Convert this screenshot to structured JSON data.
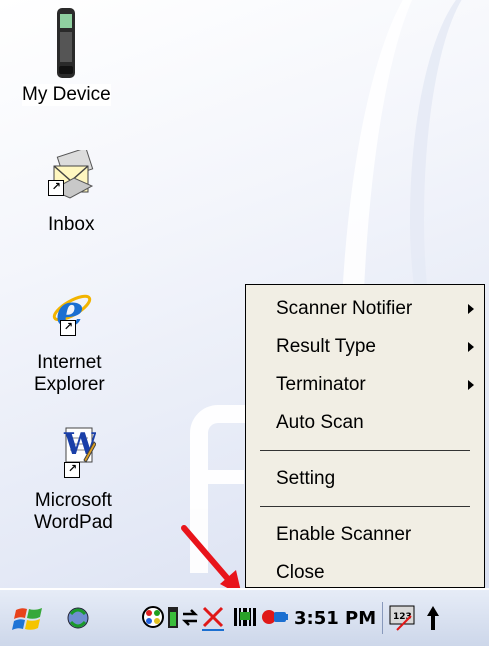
{
  "desktop": {
    "icons": [
      {
        "label": "My Device"
      },
      {
        "label": "Inbox"
      },
      {
        "label_line1": "Internet",
        "label_line2": "Explorer"
      },
      {
        "label_line1": "Microsoft",
        "label_line2": "WordPad"
      }
    ]
  },
  "context_menu": {
    "items": [
      {
        "label": "Scanner Notifier",
        "has_submenu": true
      },
      {
        "label": "Result Type",
        "has_submenu": true
      },
      {
        "label": "Terminator",
        "has_submenu": true
      },
      {
        "label": "Auto Scan",
        "has_submenu": false
      },
      {
        "label": "Setting",
        "has_submenu": false
      },
      {
        "label": "Enable Scanner",
        "has_submenu": false
      },
      {
        "label": "Close",
        "has_submenu": false
      }
    ]
  },
  "taskbar": {
    "time": "3:51 PM",
    "keyboard_label": "123"
  },
  "colors": {
    "menu_bg": "#f1eee4",
    "annotation_arrow": "#e8141b",
    "scanner_x": "#e01818",
    "ie_blue": "#1b6fd1"
  }
}
